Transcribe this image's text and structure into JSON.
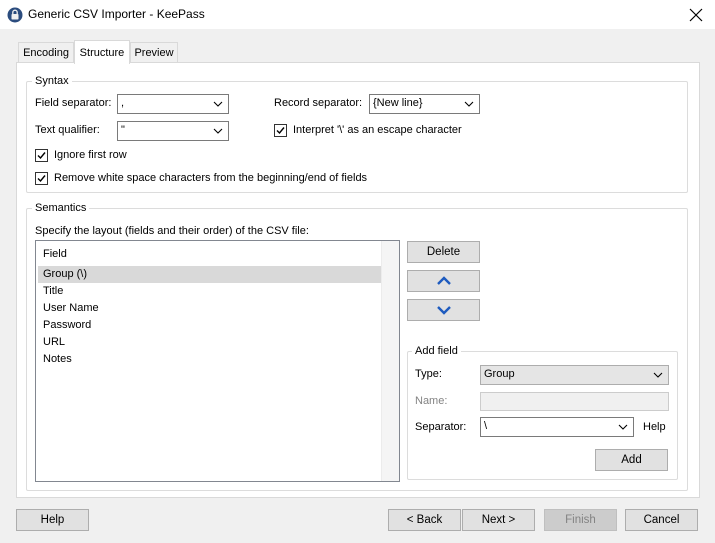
{
  "window": {
    "title": "Generic CSV Importer - KeePass"
  },
  "tabs": [
    {
      "label": "Encoding",
      "active": false
    },
    {
      "label": "Structure",
      "active": true
    },
    {
      "label": "Preview",
      "active": false
    }
  ],
  "syntax": {
    "legend": "Syntax",
    "field_separator_label": "Field separator:",
    "field_separator_value": ",",
    "record_separator_label": "Record separator:",
    "record_separator_value": "{New line}",
    "text_qualifier_label": "Text qualifier:",
    "text_qualifier_value": "\"",
    "interpret_label": "Interpret '\\' as an escape character",
    "interpret_checked": true,
    "ignore_first_row_label": "Ignore first row",
    "ignore_first_row_checked": true,
    "remove_ws_label": "Remove white space characters from the beginning/end of fields",
    "remove_ws_checked": true
  },
  "semantics": {
    "legend": "Semantics",
    "layout_label": "Specify the layout (fields and their order) of the CSV file:",
    "list_header": "Field",
    "fields": [
      "Group (\\)",
      "Title",
      "User Name",
      "Password",
      "URL",
      "Notes"
    ],
    "selected_index": 0,
    "delete_label": "Delete",
    "up_icon": "chevron-up-icon",
    "down_icon": "chevron-down-icon"
  },
  "add_field": {
    "legend": "Add field",
    "type_label": "Type:",
    "type_value": "Group",
    "name_label": "Name:",
    "separator_label": "Separator:",
    "separator_value": "\\",
    "help_label": "Help",
    "add_label": "Add"
  },
  "footer": {
    "help_label": "Help",
    "back_label": "< Back",
    "next_label": "Next >",
    "finish_label": "Finish",
    "cancel_label": "Cancel"
  },
  "colors": {
    "accent_arrow": "#1e5bbf",
    "selection": "#d9d9d9"
  }
}
